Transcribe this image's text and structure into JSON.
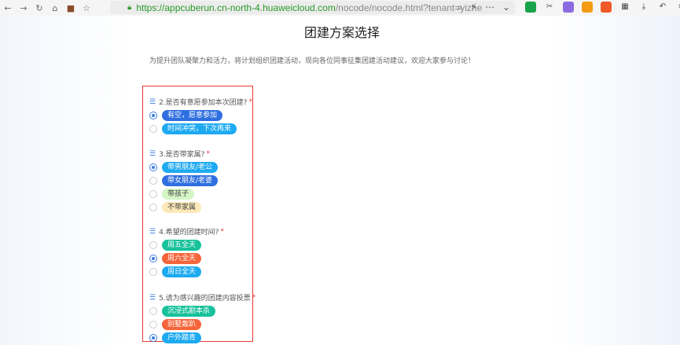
{
  "browser": {
    "url_host": "https://appcuberun.cn-north-4.huaweicloud.com",
    "url_path": "/nocode/nocode.html?tenant=yizhe"
  },
  "page": {
    "title": "团建方案选择",
    "intro": "为提升团队凝聚力和活力，将计划组织团建活动，现向各位同事征集团建活动建议，欢迎大家参与讨论！"
  },
  "questions": [
    {
      "label": "2.是否有意愿参加本次团建?",
      "required": "*",
      "options": [
        {
          "label": "有空，愿意参加",
          "color": "#2f6fe0",
          "selected": true
        },
        {
          "label": "时间冲突，下次再来",
          "color": "#1eaaf1",
          "selected": false
        }
      ]
    },
    {
      "label": "3.是否带家属?",
      "required": "*",
      "options": [
        {
          "label": "带男朋友/老公",
          "color": "#1eaaf1",
          "selected": true
        },
        {
          "label": "带女朋友/老婆",
          "color": "#2f6fe0",
          "selected": false
        },
        {
          "label": "带孩子",
          "color": "#d4f5c4",
          "text": "#444",
          "selected": false
        },
        {
          "label": "不带家属",
          "color": "#fde8b8",
          "text": "#444",
          "selected": false
        }
      ]
    },
    {
      "label": "4.希望的团建时间?",
      "required": "*",
      "options": [
        {
          "label": "周五全天",
          "color": "#17c19b",
          "selected": false
        },
        {
          "label": "周六全天",
          "color": "#f5653a",
          "selected": true
        },
        {
          "label": "周日全天",
          "color": "#1eaaf1",
          "selected": false
        }
      ]
    },
    {
      "label": "5.请为感兴趣的团建内容投票",
      "required": "*",
      "options": [
        {
          "label": "沉浸式剧本杀",
          "color": "#17c19b",
          "selected": false
        },
        {
          "label": "别墅轰趴",
          "color": "#f5653a",
          "selected": false
        },
        {
          "label": "户外踏青",
          "color": "#1eaaf1",
          "selected": true
        }
      ]
    }
  ]
}
